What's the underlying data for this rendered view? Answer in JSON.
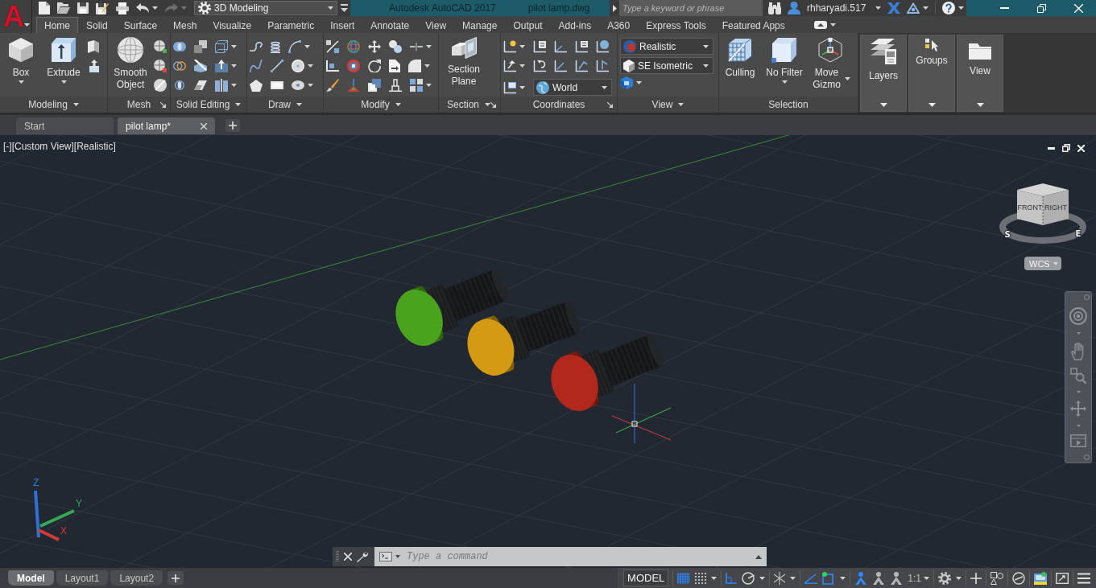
{
  "app_menu": {
    "label": "A"
  },
  "quick_access": {
    "workspace": "3D Modeling"
  },
  "title_bar": {
    "product": "Autodesk AutoCAD 2017",
    "file": "pilot lamp.dwg",
    "search": {
      "placeholder": "Type a keyword or phrase"
    },
    "user": "rhharyadi.517"
  },
  "ribbon_tabs": [
    {
      "label": "Home",
      "selected": true
    },
    {
      "label": "Solid",
      "selected": false
    },
    {
      "label": "Surface",
      "selected": false
    },
    {
      "label": "Mesh",
      "selected": false
    },
    {
      "label": "Visualize",
      "selected": false
    },
    {
      "label": "Parametric",
      "selected": false
    },
    {
      "label": "Insert",
      "selected": false
    },
    {
      "label": "Annotate",
      "selected": false
    },
    {
      "label": "View",
      "selected": false
    },
    {
      "label": "Manage",
      "selected": false
    },
    {
      "label": "Output",
      "selected": false
    },
    {
      "label": "Add-ins",
      "selected": false
    },
    {
      "label": "A360",
      "selected": false
    },
    {
      "label": "Express Tools",
      "selected": false
    },
    {
      "label": "Featured Apps",
      "selected": false
    }
  ],
  "ribbon_panels": [
    {
      "title": "Modeling",
      "menu": true,
      "launcher": false,
      "buttons": [
        {
          "label": "Box",
          "dropdown": true
        },
        {
          "label": "Extrude",
          "dropdown": true
        }
      ]
    },
    {
      "title": "Mesh",
      "menu": false,
      "launcher": true,
      "buttons": [
        {
          "label": "Smooth Object",
          "dropdown": false
        }
      ]
    },
    {
      "title": "Solid Editing",
      "menu": true,
      "launcher": false
    },
    {
      "title": "Draw",
      "menu": true,
      "launcher": false
    },
    {
      "title": "Modify",
      "menu": true,
      "launcher": false
    },
    {
      "title": "Section",
      "menu": true,
      "launcher": true,
      "buttons": [
        {
          "label": "Section Plane",
          "dropdown": false
        }
      ]
    },
    {
      "title": "Coordinates",
      "menu": false,
      "launcher": true,
      "dropdowns": [
        {
          "value": "World"
        }
      ]
    },
    {
      "title": "View",
      "menu": true,
      "launcher": false,
      "dropdowns": [
        {
          "value": "Realistic"
        },
        {
          "value": "SE Isometric"
        }
      ]
    },
    {
      "title": "Selection",
      "menu": false,
      "launcher": false,
      "buttons": [
        {
          "label": "Culling",
          "dropdown": false
        },
        {
          "label": "No Filter",
          "dropdown": true
        },
        {
          "label": "Move Gizmo",
          "dropdown": true
        }
      ]
    }
  ],
  "collapsed_panels": [
    {
      "label": "Layers"
    },
    {
      "label": "Groups"
    },
    {
      "label": "View"
    }
  ],
  "file_tabs": [
    {
      "label": "Start",
      "selected": false,
      "closable": false
    },
    {
      "label": "pilot lamp*",
      "selected": true,
      "closable": true
    }
  ],
  "viewport": {
    "controls": [
      "[-]",
      "[Custom View]",
      "[Realistic]"
    ],
    "viewcube": {
      "faces": [
        "FRONT",
        "RIGHT"
      ],
      "compass": [
        "S",
        "E"
      ]
    },
    "coordinate_system": "WCS",
    "axes": [
      "Z",
      "Y",
      "X"
    ],
    "lamps": [
      {
        "color": "#4aa31d"
      },
      {
        "color": "#d39a12"
      },
      {
        "color": "#b3281d"
      }
    ]
  },
  "command_line": {
    "placeholder": "Type a command"
  },
  "layout_tabs": [
    {
      "label": "Model",
      "selected": true
    },
    {
      "label": "Layout1",
      "selected": false
    },
    {
      "label": "Layout2",
      "selected": false
    }
  ],
  "status_bar": {
    "space": "MODEL",
    "annotation_scale": "1:1"
  }
}
